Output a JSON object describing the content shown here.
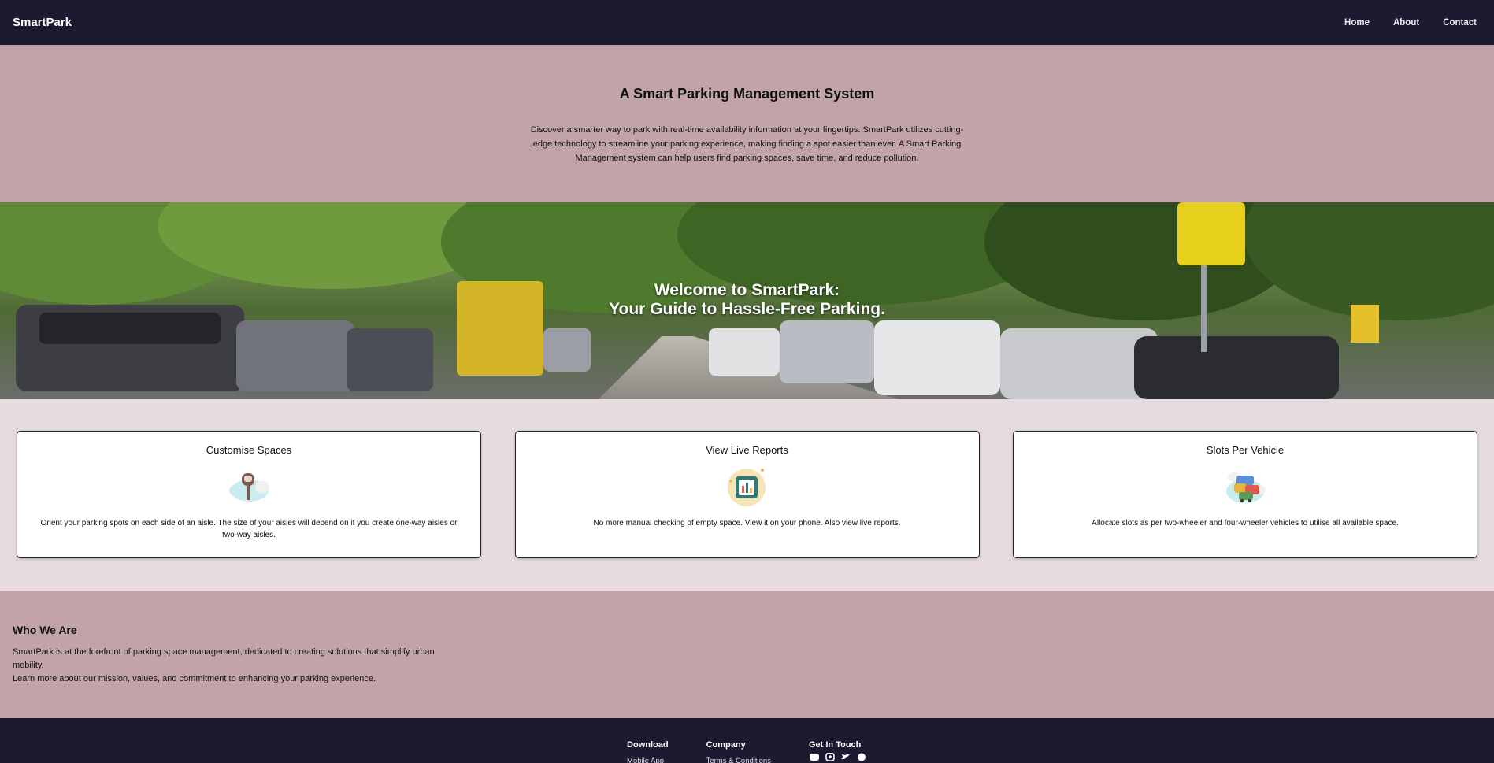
{
  "navbar": {
    "brand": "SmartPark",
    "links": [
      "Home",
      "About",
      "Contact"
    ]
  },
  "intro": {
    "title": "A Smart Parking Management System",
    "text": "Discover a smarter way to park with real-time availability information at your fingertips. SmartPark utilizes cutting-edge technology to streamline your parking experience, making finding a spot easier than ever. A Smart Parking Management system can help users find parking spaces, save time, and reduce pollution."
  },
  "hero": {
    "line1": "Welcome to SmartPark:",
    "line2": "Your Guide to Hassle-Free Parking."
  },
  "features": [
    {
      "title": "Customise Spaces",
      "icon": "parking-meter-icon",
      "text": "Orient your parking spots on each side of an aisle. The size of your aisles will depend on if you create one-way aisles or two-way aisles."
    },
    {
      "title": "View Live Reports",
      "icon": "report-chart-icon",
      "text": "No more manual checking of empty space. View it on your phone. Also view live reports."
    },
    {
      "title": "Slots Per Vehicle",
      "icon": "vehicles-icon",
      "text": "Allocate slots as per two-wheeler and four-wheeler vehicles to utilise all available space."
    }
  ],
  "who": {
    "title": "Who We Are",
    "line1": "SmartPark is at the forefront of parking space management, dedicated to creating solutions that simplify urban mobility.",
    "line2": "Learn more about our mission, values, and commitment to enhancing your parking experience."
  },
  "footer": {
    "download": {
      "title": "Download",
      "link": "Mobile App"
    },
    "company": {
      "title": "Company",
      "link": "Terms & Conditions"
    },
    "contact": {
      "title": "Get In Touch",
      "socials": [
        "discord-icon",
        "instagram-icon",
        "twitter-icon",
        "facebook-icon"
      ]
    }
  },
  "colors": {
    "nav_bg": "#1c1a31",
    "section_bg": "#c2a4a8",
    "features_bg": "#e6dcdf"
  }
}
